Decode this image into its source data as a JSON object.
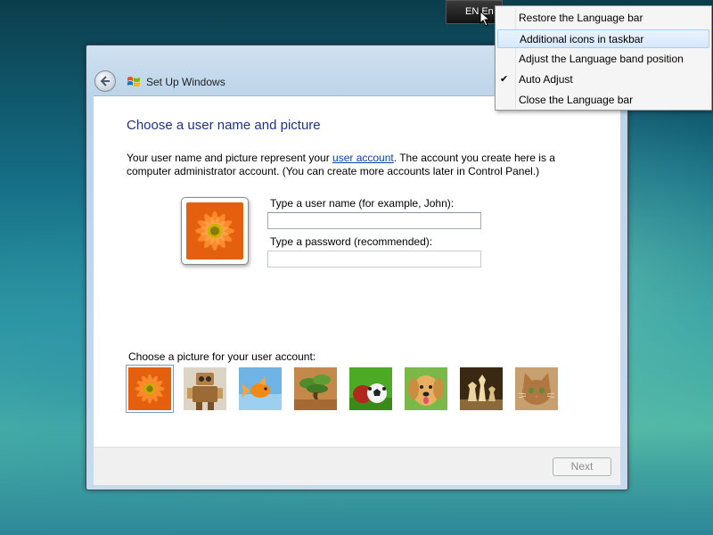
{
  "language_bar": {
    "text": "EN En"
  },
  "context_menu": {
    "items": [
      {
        "label": "Restore the Language bar",
        "checked": false
      },
      {
        "label": "Additional icons in taskbar",
        "checked": false,
        "highlighted": true
      },
      {
        "label": "Adjust the Language band position",
        "checked": false
      },
      {
        "label": "Auto Adjust",
        "checked": true
      },
      {
        "label": "Close the Language bar",
        "checked": false
      }
    ]
  },
  "window": {
    "title": "Set Up Windows",
    "heading": "Choose a user name and picture",
    "description": {
      "before_link": "Your user name and picture represent your ",
      "link": "user account",
      "after_link": ". The account you create here is a computer administrator account. (You can create more accounts later in Control Panel.)"
    },
    "username": {
      "label": "Type a user name (for example, John):",
      "value": ""
    },
    "password": {
      "label": "Type a password (recommended):",
      "value": ""
    },
    "picture_label": "Choose a picture for your user account:",
    "pictures": [
      "flower-icon",
      "robot-icon",
      "goldfish-icon",
      "bonsai-tree-icon",
      "soccer-ball-icon",
      "puppy-icon",
      "chess-pieces-icon",
      "kitten-icon"
    ],
    "selected_picture": "flower-icon",
    "next_label": "Next"
  }
}
